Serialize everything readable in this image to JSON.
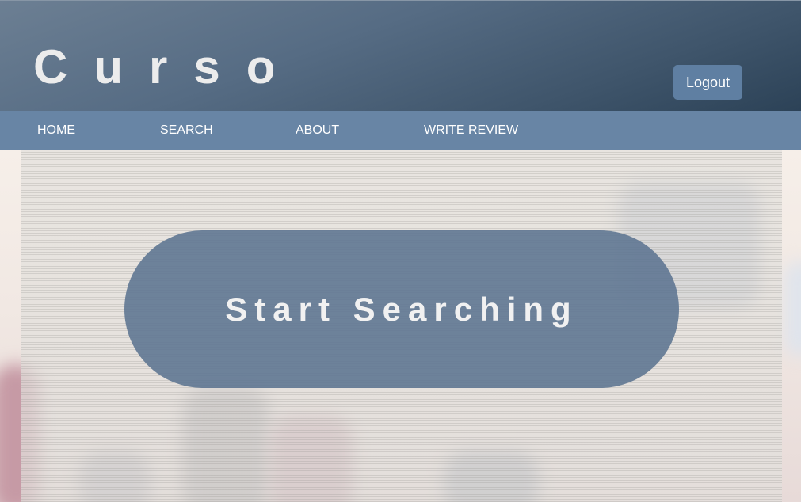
{
  "header": {
    "brand": "Curso",
    "logout_label": "Logout"
  },
  "nav": {
    "items": [
      {
        "label": "HOME"
      },
      {
        "label": "SEARCH"
      },
      {
        "label": "ABOUT"
      },
      {
        "label": "WRITE REVIEW"
      }
    ]
  },
  "hero": {
    "cta_label": "Start Searching"
  },
  "colors": {
    "header": "#4c627a",
    "nav": "#6885a5",
    "button": "#5f7fa2",
    "cta": "#5c7491"
  }
}
